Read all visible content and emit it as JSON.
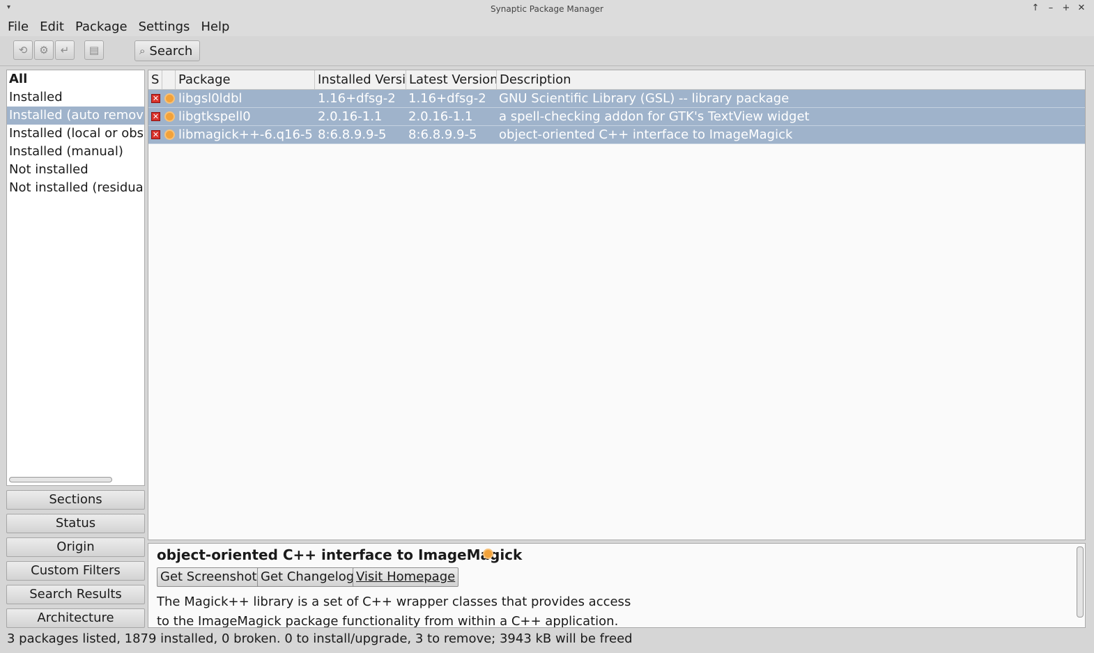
{
  "window": {
    "title": "Synaptic Package Manager",
    "menu_icon": "▾",
    "controls": [
      "↑",
      "–",
      "+",
      "✕"
    ]
  },
  "menubar": [
    "File",
    "Edit",
    "Package",
    "Settings",
    "Help"
  ],
  "toolbar": {
    "reload_icon": "reload-icon",
    "mark_upgrades_icon": "gear-icon",
    "apply_icon": "apply-icon",
    "properties_icon": "properties-icon",
    "search_label": "Search"
  },
  "filters": {
    "items": [
      {
        "label": "All",
        "bold": true
      },
      {
        "label": "Installed"
      },
      {
        "label": "Installed (auto removal)",
        "selected": true
      },
      {
        "label": "Installed (local or obsolete)"
      },
      {
        "label": "Installed (manual)"
      },
      {
        "label": "Not installed"
      },
      {
        "label": "Not installed (residual config)"
      }
    ],
    "buttons": [
      "Sections",
      "Status",
      "Origin",
      "Custom Filters",
      "Search Results",
      "Architecture"
    ]
  },
  "package_list": {
    "columns": [
      "S",
      "",
      "Package",
      "Installed Version",
      "Latest Version",
      "Description"
    ],
    "rows": [
      {
        "package": "libgsl0ldbl",
        "installed": "1.16+dfsg-2",
        "latest": "1.16+dfsg-2",
        "description": "GNU Scientific Library (GSL) -- library package"
      },
      {
        "package": "libgtkspell0",
        "installed": "2.0.16-1.1",
        "latest": "2.0.16-1.1",
        "description": "a spell-checking addon for GTK's TextView widget"
      },
      {
        "package": "libmagick++-6.q16-5",
        "installed": "8:6.8.9.9-5",
        "latest": "8:6.8.9.9-5",
        "description": "object-oriented C++ interface to ImageMagick"
      }
    ]
  },
  "details": {
    "title": "object-oriented C++ interface to ImageMagick",
    "buttons": [
      "Get Screenshot",
      "Get Changelog",
      "Visit Homepage"
    ],
    "description_lines": [
      "The Magick++ library is a set of C++ wrapper classes that provides access",
      "to the ImageMagick package functionality from within a C++ application."
    ]
  },
  "status": "3 packages listed, 1879 installed, 0 broken. 0 to install/upgrade, 3 to remove; 3943 kB will be freed"
}
